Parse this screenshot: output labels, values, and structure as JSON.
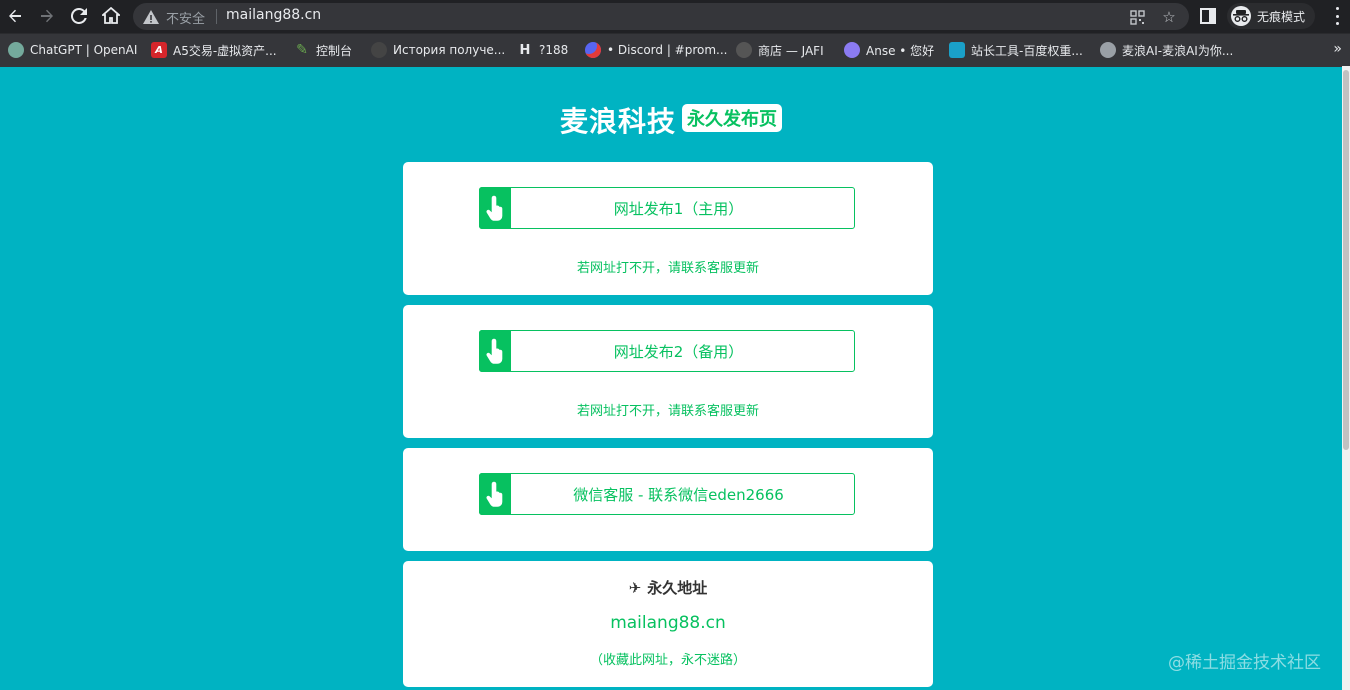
{
  "browser": {
    "security_label": "不安全",
    "url": "mailang88.cn",
    "incognito_label": "无痕模式"
  },
  "bookmarks": [
    {
      "label": "ChatGPT | OpenAI",
      "icon": "openai-icon",
      "color": "#74aa9c"
    },
    {
      "label": "A5交易-虚拟资产...",
      "icon": "a5-icon",
      "color": "#d6262b"
    },
    {
      "label": "控制台",
      "icon": "console-icon",
      "color": "#6aa84f"
    },
    {
      "label": "История получе...",
      "icon": "history-icon",
      "color": "#444444"
    },
    {
      "label": "?188",
      "icon": "h-icon",
      "color": "#202124"
    },
    {
      "label": "• Discord | #prom...",
      "icon": "discord-icon",
      "color": "#5865f2"
    },
    {
      "label": "商店 — JAFI",
      "icon": "store-icon",
      "color": "#555555"
    },
    {
      "label": "Anse • 您好",
      "icon": "anse-icon",
      "color": "#8b7bf2"
    },
    {
      "label": "站长工具-百度权重...",
      "icon": "webmaster-icon",
      "color": "#1aa0c8"
    },
    {
      "label": "麦浪AI-麦浪AI为你...",
      "icon": "globe-icon",
      "color": "#9aa0a6"
    }
  ],
  "page": {
    "title": "麦浪科技",
    "badge": "永久发布页"
  },
  "links": [
    {
      "label": "网址发布1（主用）",
      "note": "若网址打不开，请联系客服更新"
    },
    {
      "label": "网址发布2（备用）",
      "note": "若网址打不开，请联系客服更新"
    },
    {
      "label": "微信客服 - 联系微信eden2666"
    }
  ],
  "permanent": {
    "icon": "✈",
    "title": "永久地址",
    "url": "mailang88.cn",
    "note": "（收藏此网址，永不迷路）"
  },
  "watermark": "@稀土掘金技术社区",
  "colors": {
    "background": "#00b3c2",
    "accent": "#07c160"
  }
}
